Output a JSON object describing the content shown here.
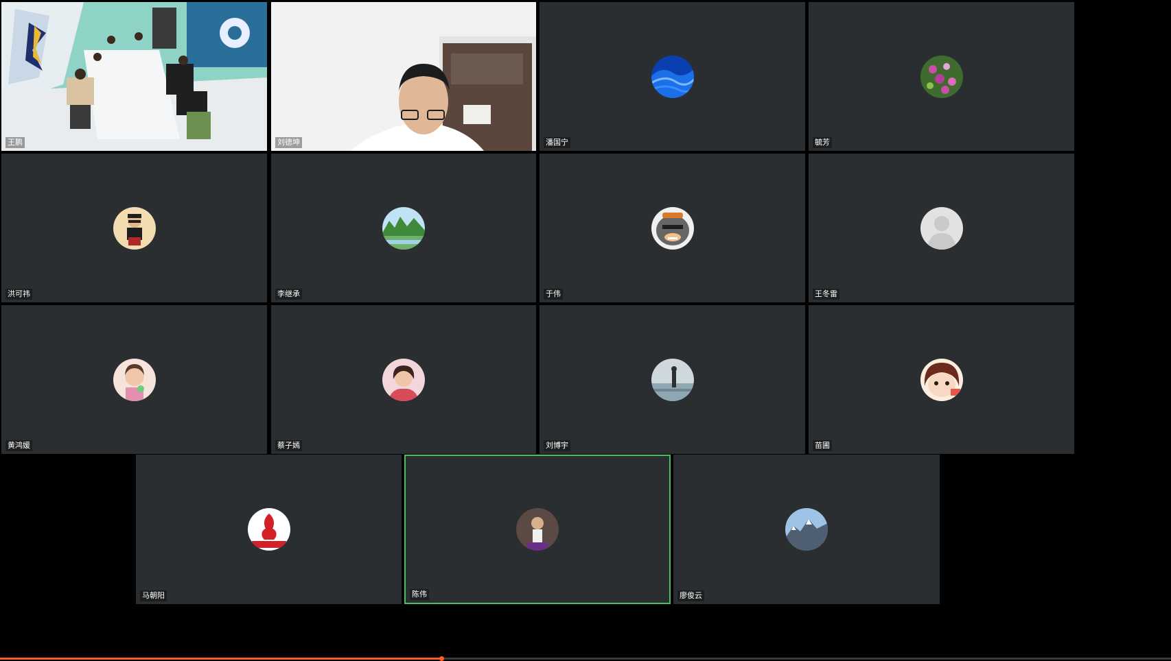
{
  "meeting": {
    "participants": [
      {
        "name": "王鹏",
        "type": "video",
        "scene": "meeting-room"
      },
      {
        "name": "刘德坤",
        "type": "video",
        "scene": "person-at-desk"
      },
      {
        "name": "潘国宁",
        "type": "avatar",
        "avatar": "blue-wave",
        "color": "#1b5fd6"
      },
      {
        "name": "毓芳",
        "type": "avatar",
        "avatar": "flowers",
        "color": "#4f7a3a"
      },
      {
        "name": "洪可祎",
        "type": "avatar",
        "avatar": "cartoon-man",
        "color": "#f0d9a8"
      },
      {
        "name": "李继承",
        "type": "avatar",
        "avatar": "landscape-river",
        "color": "#5aa04a"
      },
      {
        "name": "于伟",
        "type": "avatar",
        "avatar": "wolf-cartoon",
        "color": "#7c7c7c"
      },
      {
        "name": "王冬雷",
        "type": "avatar",
        "avatar": "default-user",
        "color": "#d9d9d9"
      },
      {
        "name": "黄鸿媛",
        "type": "avatar",
        "avatar": "child-photo",
        "color": "#f2d1c6"
      },
      {
        "name": "蔡子嫣",
        "type": "avatar",
        "avatar": "girl-photo",
        "color": "#d84b5a"
      },
      {
        "name": "刘博宇",
        "type": "avatar",
        "avatar": "lake-figure",
        "color": "#8fa6b3"
      },
      {
        "name": "苗圃",
        "type": "avatar",
        "avatar": "cartoon-girl",
        "color": "#e8544c"
      },
      {
        "name": "马朝阳",
        "type": "avatar",
        "avatar": "liverpool-crest",
        "color": "#d32026"
      },
      {
        "name": "陈伟",
        "type": "avatar",
        "avatar": "man-photo",
        "color": "#6b5a5a",
        "active_speaker": true
      },
      {
        "name": "廖俊云",
        "type": "avatar",
        "avatar": "mountains",
        "color": "#8aa7c4"
      }
    ]
  },
  "playback": {
    "progress": 0.377
  }
}
